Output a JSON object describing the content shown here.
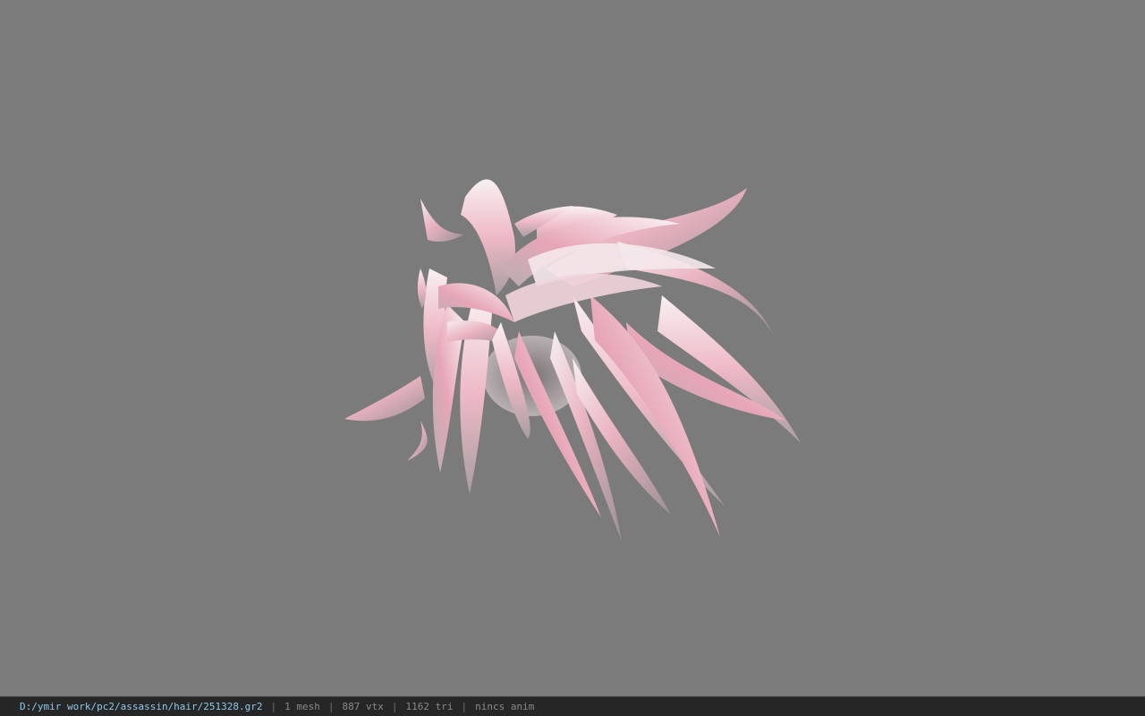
{
  "viewer": {
    "background_color": "#7b7b7b",
    "model_subject": "pink hair mesh",
    "model_colors": {
      "base": "#f3e6e9",
      "pink": "#e9a9b9",
      "shadow": "#8f8789"
    }
  },
  "status_bar": {
    "file_path": "D:/ymir work/pc2/assassin/hair/251328.gr2",
    "separator": "|",
    "mesh_count": "1 mesh",
    "vertex_count": "887 vtx",
    "triangle_count": "1162 tri",
    "anim_status": "nincs anim"
  }
}
